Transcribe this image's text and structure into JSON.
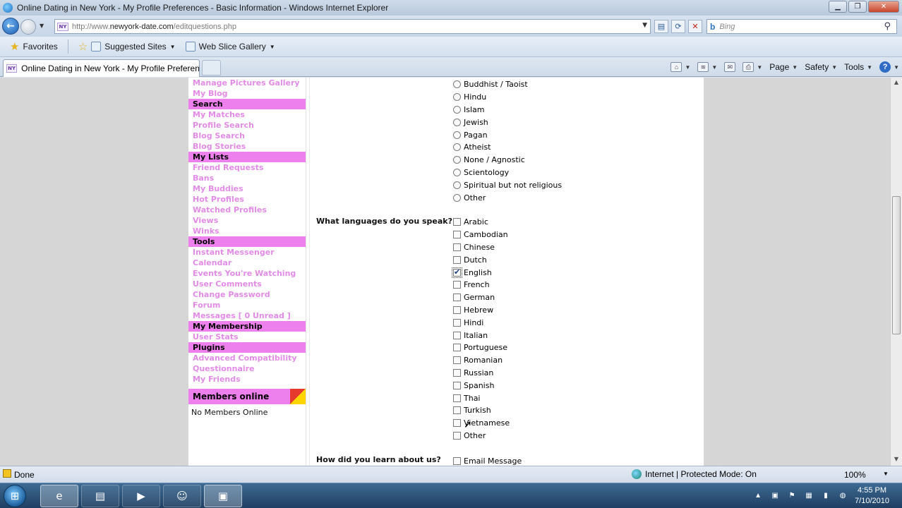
{
  "window": {
    "title": "Online Dating in New York - My Profile Preferences - Basic Information - Windows Internet Explorer",
    "buttons": [
      "▁",
      "❐",
      "✕"
    ]
  },
  "address": {
    "url_prefix": "http://www.",
    "url_domain": "newyork-date.com",
    "url_path": "/editquestions.php",
    "favicon": "NY"
  },
  "search": {
    "placeholder": "Bing",
    "brand": "b"
  },
  "favorites": {
    "favorites_label": "Favorites",
    "suggested_label": "Suggested Sites",
    "webslice_label": "Web Slice Gallery"
  },
  "tab": {
    "label": "Online Dating in New York - My Profile Preferenc..."
  },
  "commandbar": {
    "page_label": "Page",
    "safety_label": "Safety",
    "tools_label": "Tools"
  },
  "sidebar": {
    "items": [
      {
        "label": "Manage Pictures Gallery",
        "type": "link"
      },
      {
        "label": "My Blog",
        "type": "link"
      },
      {
        "label": "Search",
        "type": "head"
      },
      {
        "label": "My Matches",
        "type": "link"
      },
      {
        "label": "Profile Search",
        "type": "link"
      },
      {
        "label": "Blog Search",
        "type": "link"
      },
      {
        "label": "Blog Stories",
        "type": "link"
      },
      {
        "label": "My Lists",
        "type": "head"
      },
      {
        "label": "Friend Requests",
        "type": "link"
      },
      {
        "label": "Bans",
        "type": "link"
      },
      {
        "label": "My Buddies",
        "type": "link"
      },
      {
        "label": "Hot Profiles",
        "type": "link"
      },
      {
        "label": "Watched Profiles",
        "type": "link"
      },
      {
        "label": "Views",
        "type": "link"
      },
      {
        "label": "Winks",
        "type": "link"
      },
      {
        "label": "Tools",
        "type": "head"
      },
      {
        "label": "Instant Messenger",
        "type": "link"
      },
      {
        "label": "Calendar",
        "type": "link"
      },
      {
        "label": "Events You're Watching",
        "type": "link"
      },
      {
        "label": "User Comments",
        "type": "link"
      },
      {
        "label": "Change Password",
        "type": "link"
      },
      {
        "label": "Forum",
        "type": "link"
      },
      {
        "label": "Messages [ 0 Unread ]",
        "type": "link"
      },
      {
        "label": "My Membership",
        "type": "head"
      },
      {
        "label": "User Stats",
        "type": "link"
      },
      {
        "label": "Plugins",
        "type": "head"
      },
      {
        "label": "Advanced Compatibility",
        "type": "link"
      },
      {
        "label": "Questionnaire",
        "type": "link"
      },
      {
        "label": "My Friends",
        "type": "link"
      }
    ],
    "members_title": "Members online",
    "members_text": "No Members Online"
  },
  "religion_options": [
    {
      "label": "Buddhist / Taoist",
      "checked": false
    },
    {
      "label": "Hindu",
      "checked": false
    },
    {
      "label": "Islam",
      "checked": false
    },
    {
      "label": "Jewish",
      "checked": false
    },
    {
      "label": "Pagan",
      "checked": false
    },
    {
      "label": "Atheist",
      "checked": false
    },
    {
      "label": "None / Agnostic",
      "checked": false
    },
    {
      "label": "Scientology",
      "checked": false
    },
    {
      "label": "Spiritual but not religious",
      "checked": false
    },
    {
      "label": "Other",
      "checked": false
    }
  ],
  "languages": {
    "question": "What languages do you speak?",
    "options": [
      {
        "label": "Arabic",
        "checked": false
      },
      {
        "label": "Cambodian",
        "checked": false
      },
      {
        "label": "Chinese",
        "checked": false
      },
      {
        "label": "Dutch",
        "checked": false
      },
      {
        "label": "English",
        "checked": true
      },
      {
        "label": "French",
        "checked": false
      },
      {
        "label": "German",
        "checked": false
      },
      {
        "label": "Hebrew",
        "checked": false
      },
      {
        "label": "Hindi",
        "checked": false
      },
      {
        "label": "Italian",
        "checked": false
      },
      {
        "label": "Portuguese",
        "checked": false
      },
      {
        "label": "Romanian",
        "checked": false
      },
      {
        "label": "Russian",
        "checked": false
      },
      {
        "label": "Spanish",
        "checked": false
      },
      {
        "label": "Thai",
        "checked": false
      },
      {
        "label": "Turkish",
        "checked": false
      },
      {
        "label": "Vietnamese",
        "checked": false
      },
      {
        "label": "Other",
        "checked": false
      }
    ]
  },
  "learn": {
    "question": "How did you learn about us?",
    "options": [
      {
        "label": "Email Message",
        "checked": false
      }
    ]
  },
  "status": {
    "text": "Done",
    "zone": "Internet | Protected Mode: On",
    "zoom": "100%"
  },
  "taskbar": {
    "time": "4:55 PM",
    "date": "7/10/2010"
  }
}
